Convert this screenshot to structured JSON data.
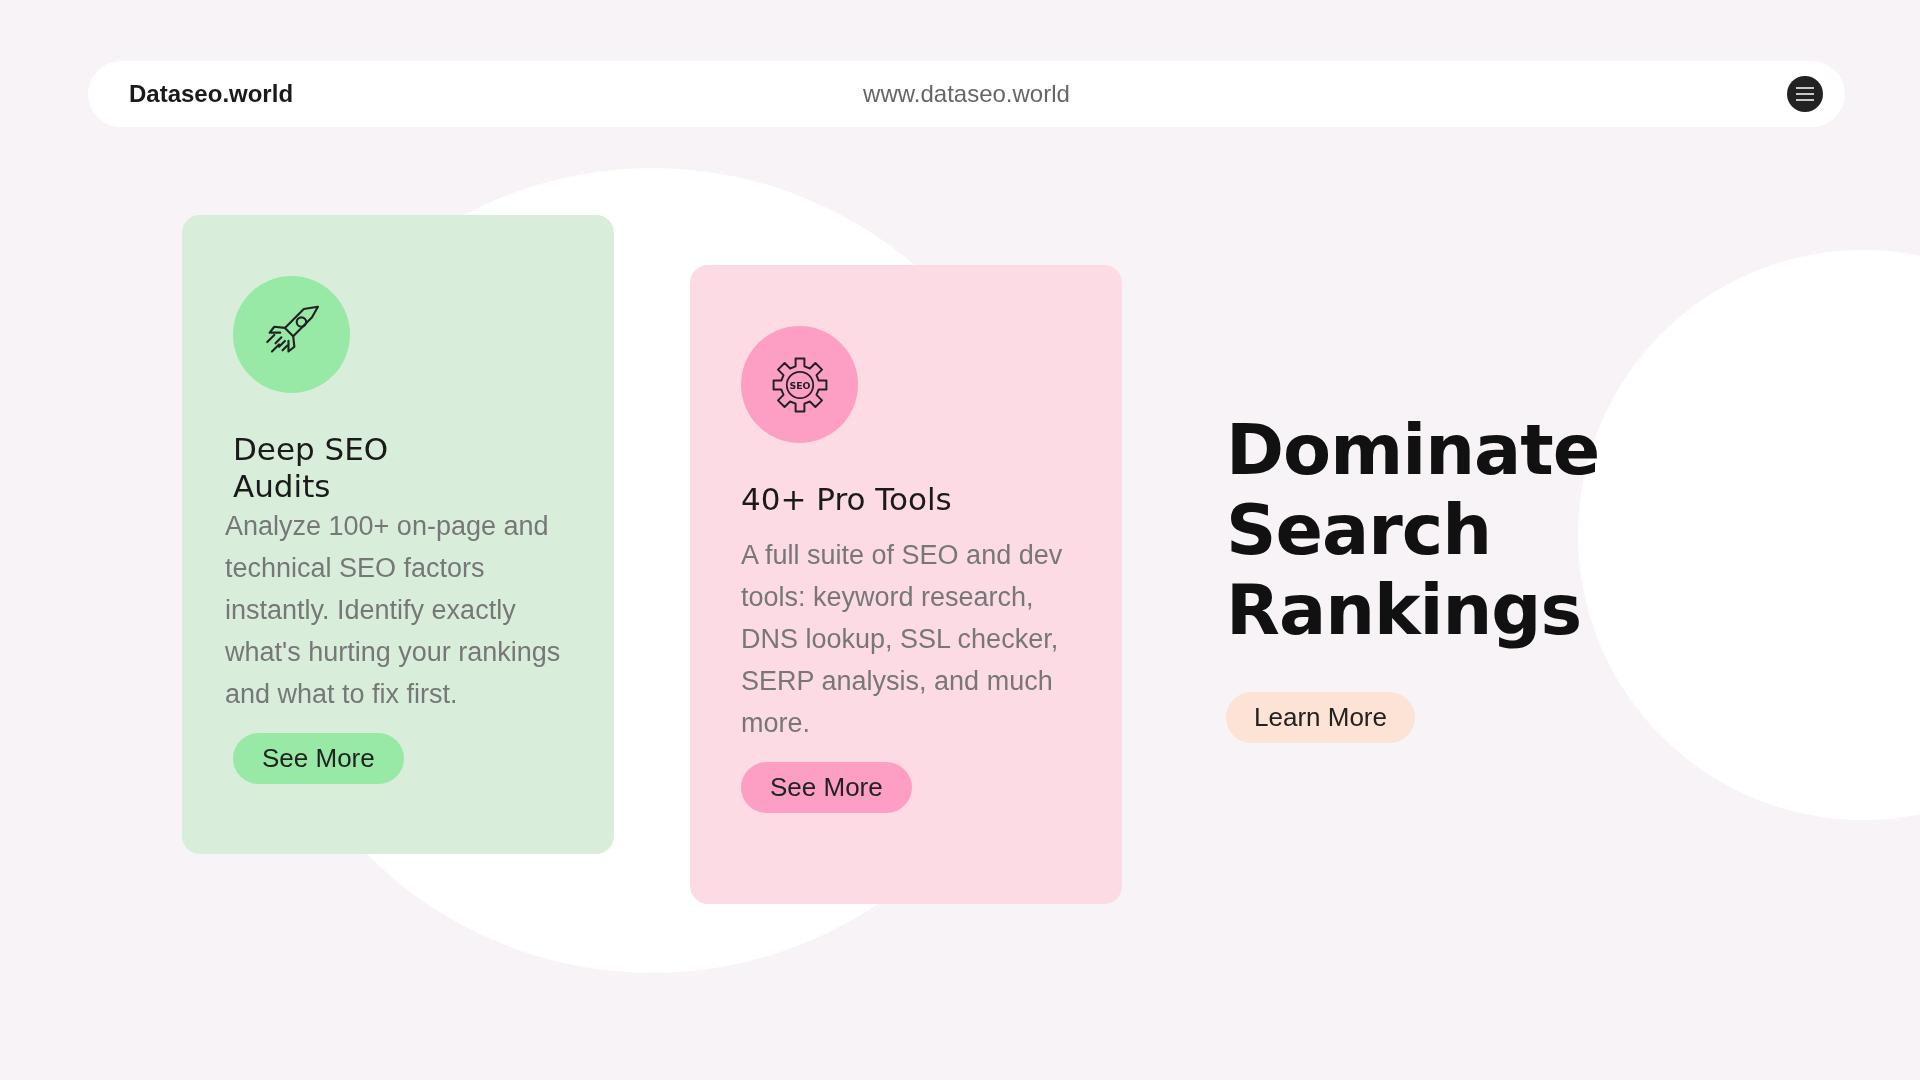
{
  "header": {
    "brand": "Dataseo.world",
    "url": "www.dataseo.world"
  },
  "cards": [
    {
      "kind": "rocket",
      "color": "#d8eedb",
      "title": "Deep SEO Audits",
      "description": "Analyze 100+ on-page and technical SEO factors instantly. Identify exactly what's hurting your rankings and what to fix first.",
      "button": "See More"
    },
    {
      "kind": "gear",
      "color": "#fddbe5",
      "icon_text": "SEO",
      "title": "40+ Pro Tools",
      "description": "A full suite of SEO and dev tools: keyword research, DNS lookup, SSL checker, SERP analysis, and much more.",
      "button": "See More"
    }
  ],
  "hero": {
    "heading": "Dominate Search Rankings",
    "button": "Learn More"
  }
}
